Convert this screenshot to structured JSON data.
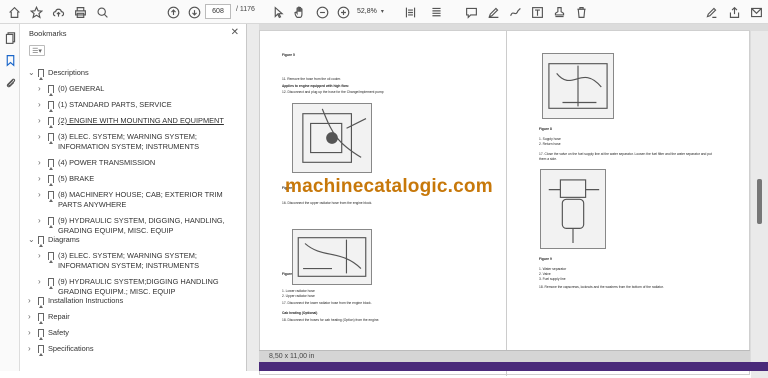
{
  "toolbar": {
    "page_current": "608",
    "page_total": "/ 1176",
    "zoom": "52,8%"
  },
  "panel": {
    "title": "Bookmarks",
    "close": "✕",
    "options": "☰▾"
  },
  "bookmarks": [
    {
      "label": "Descriptions",
      "level": 0,
      "expanded": true
    },
    {
      "label": "(0) GENERAL",
      "level": 1,
      "expanded": false
    },
    {
      "label": "(1) STANDARD PARTS, SERVICE",
      "level": 1,
      "expanded": false
    },
    {
      "label": "(2) ENGINE WITH MOUNTING AND EQUIPMENT",
      "level": 1,
      "expanded": false,
      "link": true
    },
    {
      "label": "(3) ELEC. SYSTEM; WARNING SYSTEM; INFORMATION SYSTEM; INSTRUMENTS",
      "level": 1,
      "expanded": false
    },
    {
      "label": "(4) POWER TRANSMISSION",
      "level": 1,
      "expanded": false
    },
    {
      "label": "(5) BRAKE",
      "level": 1,
      "expanded": false
    },
    {
      "label": "(8) MACHINERY HOUSE; CAB; EXTERIOR TRIM PARTS ANYWHERE",
      "level": 1,
      "expanded": false
    },
    {
      "label": "(9) HYDRAULIC SYSTEM, DIGGING, HANDLING, GRADING EQUIPM, MISC. EQUIP",
      "level": 1,
      "expanded": false
    },
    {
      "label": "Diagrams",
      "level": 0,
      "expanded": true
    },
    {
      "label": "(3) ELEC. SYSTEM; WARNING SYSTEM; INFORMATION SYSTEM; INSTRUMENTS",
      "level": 1,
      "expanded": false
    },
    {
      "label": "(9) HYDRAULIC SYSTEM;DIGGING HANDLING GRADING EQUIPM.; MISC. EQUIP",
      "level": 1,
      "expanded": false
    },
    {
      "label": "Installation Instructions",
      "level": 0,
      "expanded": false
    },
    {
      "label": "Repair",
      "level": 0,
      "expanded": false
    },
    {
      "label": "Safety",
      "level": 0,
      "expanded": false
    },
    {
      "label": "Specifications",
      "level": 0,
      "expanded": false
    }
  ],
  "document": {
    "left_column": [
      "Figure 5",
      "11.    Remove the hose from the oil cooler.",
      "Applies to engine equipped with high flow:",
      "12.    Disconnect and plug up the hose for the Change/implement pump",
      "Figure 6",
      "16.    Disconnect the upper radiator hose from the engine block.",
      "Figure 7",
      "1.    Lower radiator hose",
      "2.    Upper radiator hose",
      "17.    Disconnect the lower radiator hose from the engine block.",
      "Cab heating (Optional)",
      "18.    Disconnect the hoses for cab heating (Option) from the engine."
    ],
    "right_column": [
      "Figure 8",
      "1.    Supply hose",
      "2.    Return hose",
      "17.    Close the valve on the fuel supply line at the water separator. Loosen the fuel filter and the water separator and put",
      "them a side.",
      "Figure 9",
      "1.    Water separator",
      "2.    Valve",
      "3.    Fuel supply line",
      "18.    Remove the capscrews, locknuts and the washers from the bottom of the radiator."
    ],
    "watermark": "machinecatalogic.com",
    "page_size": "8,50 x 11,00 in"
  }
}
